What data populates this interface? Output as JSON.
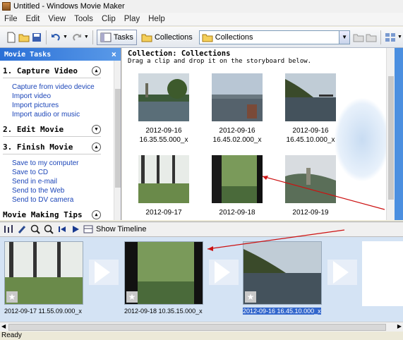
{
  "window": {
    "title": "Untitled - Windows Movie Maker"
  },
  "menu": [
    "File",
    "Edit",
    "View",
    "Tools",
    "Clip",
    "Play",
    "Help"
  ],
  "toolbar": {
    "tasks_label": "Tasks",
    "collections_label": "Collections",
    "collection_select": "Collections"
  },
  "tasks_pane": {
    "title": "Movie Tasks",
    "close_glyph": "×",
    "sections": [
      {
        "title": "1. Capture Video",
        "items": [
          "Capture from video device",
          "Import video",
          "Import pictures",
          "Import audio or music"
        ]
      },
      {
        "title": "2. Edit Movie",
        "items": []
      },
      {
        "title": "3. Finish Movie",
        "items": [
          "Save to my computer",
          "Save to CD",
          "Send in e-mail",
          "Send to the Web",
          "Send to DV camera"
        ]
      },
      {
        "title": "Movie Making Tips",
        "items": []
      }
    ]
  },
  "collection": {
    "title": "Collection: Collections",
    "subtitle": "Drag a clip and drop it on the storyboard below.",
    "clips": [
      {
        "line1": "2012-09-16",
        "line2": "16.35.55.000_x"
      },
      {
        "line1": "2012-09-16",
        "line2": "16.45.02.000_x"
      },
      {
        "line1": "2012-09-16",
        "line2": "16.45.10.000_x"
      },
      {
        "line1": "2012-09-17",
        "line2": ""
      },
      {
        "line1": "2012-09-18",
        "line2": ""
      },
      {
        "line1": "2012-09-19",
        "line2": ""
      }
    ]
  },
  "storyboard": {
    "show_timeline_label": "Show Timeline",
    "clips": [
      {
        "caption": "2012-09-17 11.55.09.000_x"
      },
      {
        "caption": "2012-09-18 10.35.15.000_x"
      },
      {
        "caption": "2012-09-16 16.45.10.000_x",
        "selected": true
      }
    ]
  },
  "status": {
    "text": "Ready"
  },
  "colors": {
    "accent": "#2a6fd6",
    "link": "#1b45b8",
    "arrow": "#cc1111",
    "selection": "#3266cc"
  }
}
